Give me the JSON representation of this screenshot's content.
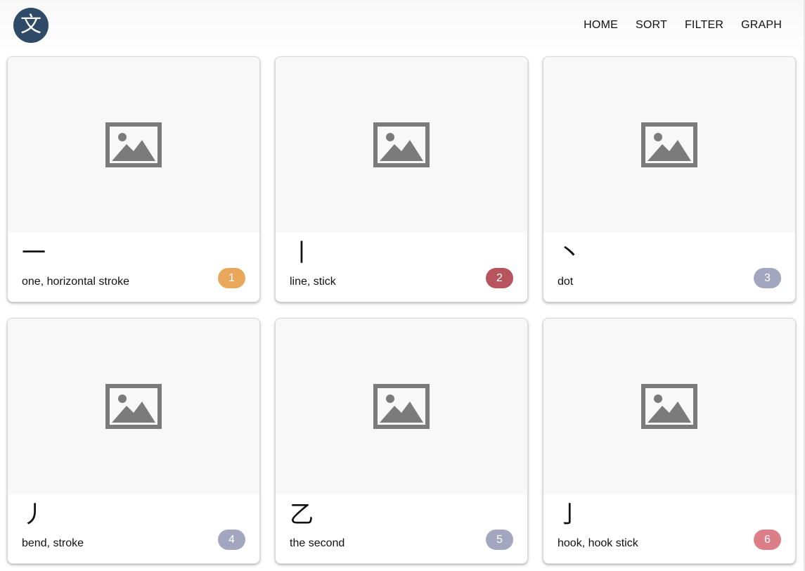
{
  "header": {
    "logo_char": "文",
    "nav": [
      {
        "label": "HOME"
      },
      {
        "label": "SORT"
      },
      {
        "label": "FILTER"
      },
      {
        "label": "GRAPH"
      }
    ]
  },
  "cards": [
    {
      "radical": "一",
      "meaning": "one, horizontal stroke",
      "number": "1",
      "badge_color": "#e9a75b"
    },
    {
      "radical": "丨",
      "meaning": "line, stick",
      "number": "2",
      "badge_color": "#b7545e"
    },
    {
      "radical": "丶",
      "meaning": "dot",
      "number": "3",
      "badge_color": "#a3a6bf"
    },
    {
      "radical": "丿",
      "meaning": "bend, stroke",
      "number": "4",
      "badge_color": "#a3a6bf"
    },
    {
      "radical": "乙",
      "meaning": "the second",
      "number": "5",
      "badge_color": "#a3a6bf"
    },
    {
      "radical": "亅",
      "meaning": "hook, hook stick",
      "number": "6",
      "badge_color": "#dc7e88"
    }
  ],
  "placeholder_icon": "image-placeholder-icon",
  "colors": {
    "logo_bg": "#2e4a66",
    "placeholder_icon": "#7b7b7b"
  }
}
